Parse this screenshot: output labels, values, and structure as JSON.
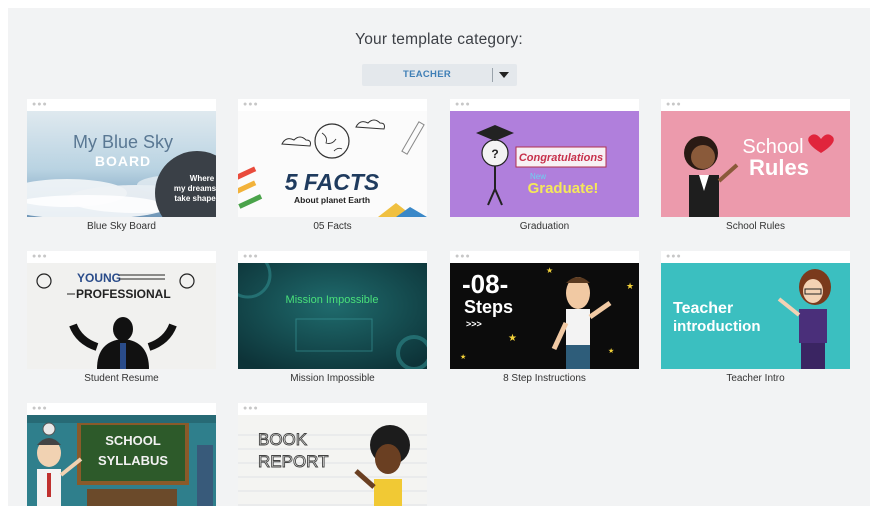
{
  "header": {
    "title": "Your template category:"
  },
  "category_select": {
    "selected": "TEACHER"
  },
  "templates": [
    {
      "title": "Blue Sky Board",
      "thumb": {
        "line1": "My Blue Sky",
        "line2": "BOARD",
        "badge1": "Where",
        "badge2": "my dreams",
        "badge3": "take shape"
      }
    },
    {
      "title": "05 Facts",
      "thumb": {
        "line1": "5 FACTS",
        "line2": "About planet Earth"
      }
    },
    {
      "title": "Graduation",
      "thumb": {
        "line1": "Congratulations",
        "line2": "New",
        "line3": "Graduate!"
      }
    },
    {
      "title": "School Rules",
      "thumb": {
        "line1": "School",
        "line2": "Rules"
      }
    },
    {
      "title": "Student Resume",
      "thumb": {
        "line1": "YOUNG",
        "line2": "PROFESSIONAL"
      }
    },
    {
      "title": "Mission Impossible",
      "thumb": {
        "line1": "Mission Impossible"
      }
    },
    {
      "title": "8 Step Instructions",
      "thumb": {
        "line1": "-08-",
        "line2": "Steps",
        "line3": ">>>"
      }
    },
    {
      "title": "Teacher Intro",
      "thumb": {
        "line1": "Teacher",
        "line2": "introduction"
      }
    },
    {
      "title": "",
      "thumb": {
        "line1": "SCHOOL",
        "line2": "SYLLABUS"
      }
    },
    {
      "title": "",
      "thumb": {
        "line1": "BOOK",
        "line2": "REPORT"
      }
    }
  ]
}
